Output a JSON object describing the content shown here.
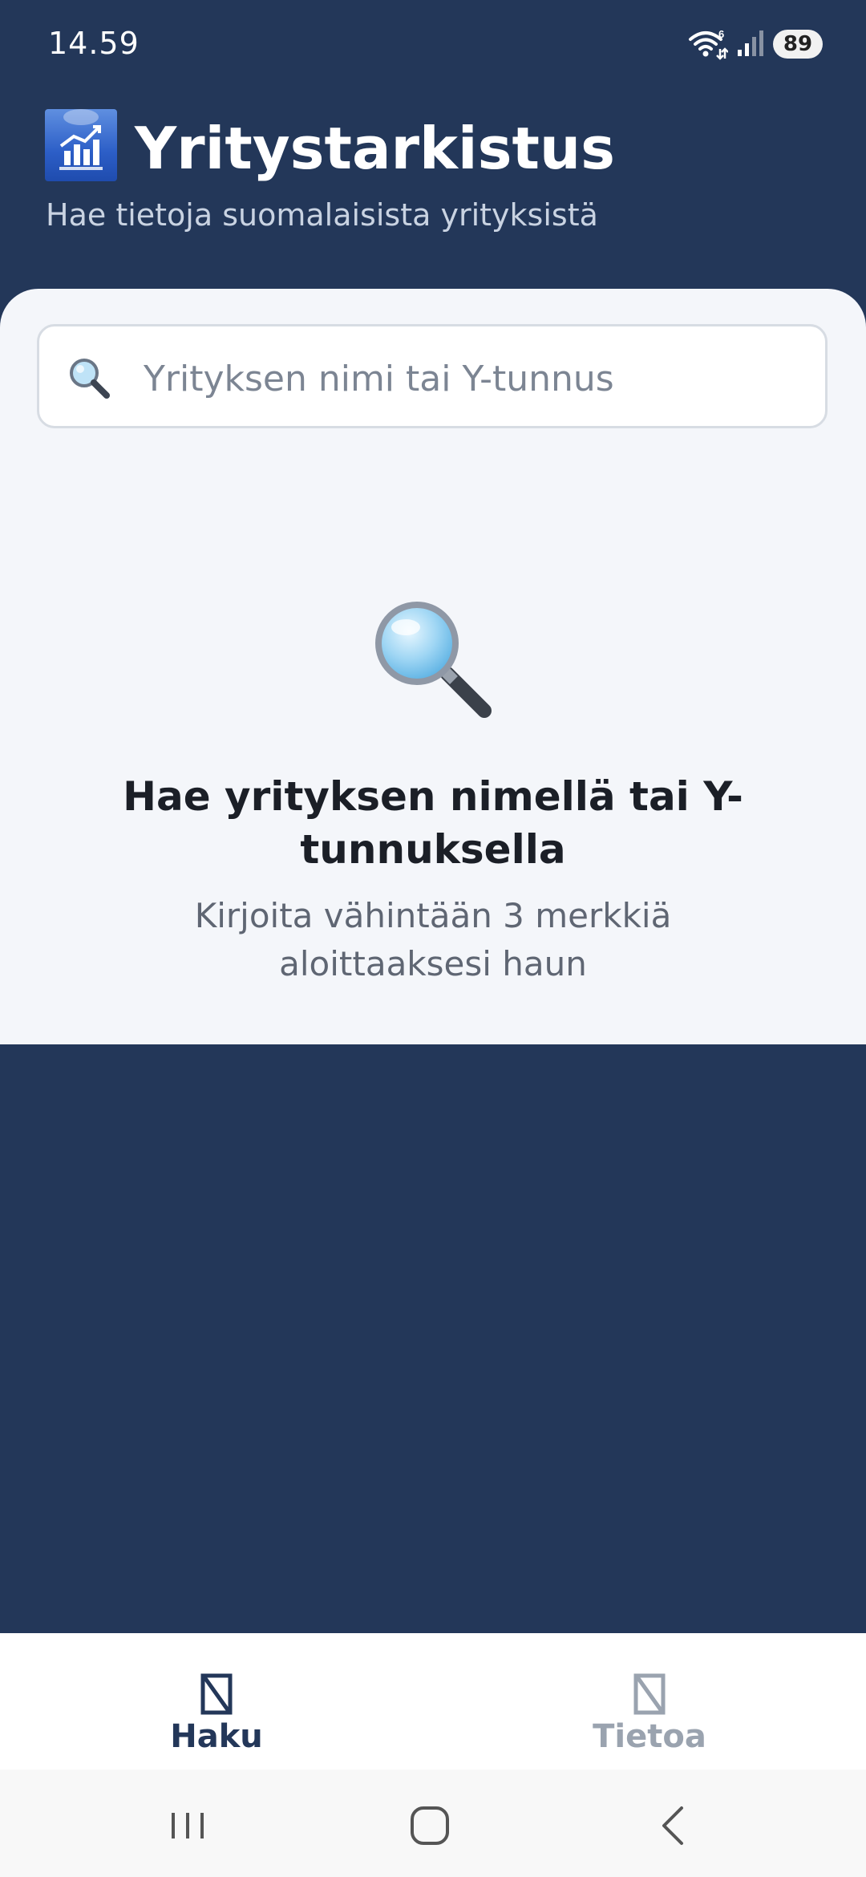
{
  "status_bar": {
    "time": "14.59",
    "battery": "89",
    "wifi_badge": "6"
  },
  "header": {
    "title": "Yritystarkistus",
    "subtitle": "Hae tietoja suomalaisista yrityksistä",
    "logo_icon": "bar-chart-growth-icon"
  },
  "search": {
    "placeholder": "Yrityksen nimi tai Y-tunnus",
    "value": "",
    "icon": "magnifier-icon"
  },
  "empty_state": {
    "icon": "magnifying-glass-icon",
    "title": "Hae yrityksen nimellä tai Y-tunnuksella",
    "subtitle": "Kirjoita vähintään 3 merkkiä aloittaaksesi haun"
  },
  "tabs": [
    {
      "label": "Haku",
      "icon": "missing-glyph-icon",
      "active": true
    },
    {
      "label": "Tietoa",
      "icon": "missing-glyph-icon",
      "active": false
    }
  ],
  "colors": {
    "brand_navy": "#233759",
    "panel_background": "#f4f6fa",
    "inactive_tab": "#9aa3af"
  }
}
